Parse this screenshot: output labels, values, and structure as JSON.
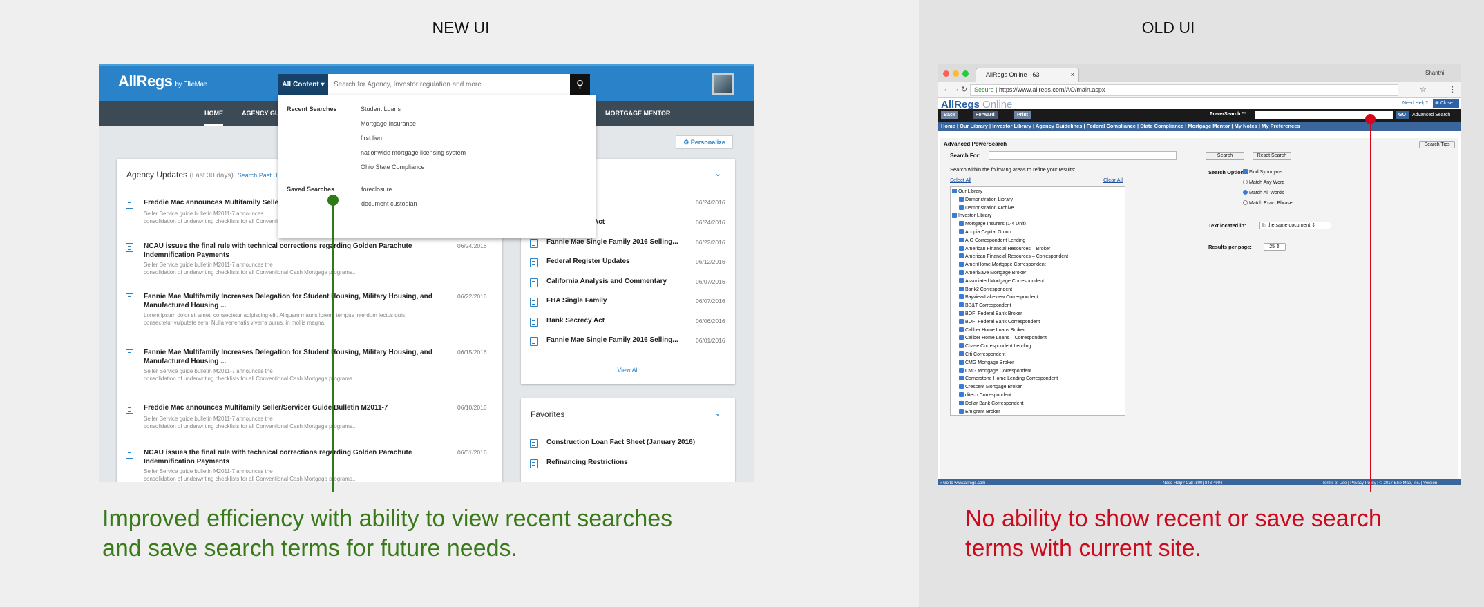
{
  "headings": {
    "new": "NEW UI",
    "old": "OLD UI"
  },
  "captions": {
    "new_lines": [
      "Improved efficiency with ability to view recent searches",
      "and save search terms for future needs."
    ],
    "old_lines": [
      "No ability to show recent or save search",
      "terms with current site."
    ],
    "colors": {
      "new": "#3a7a1a",
      "old": "#cc0a1e",
      "new_marker": "#2f7a17",
      "old_marker": "#d3061b"
    }
  },
  "new_ui": {
    "logo": "AllRegs",
    "logo_suffix": "by EllieMae",
    "search": {
      "scope": "All Content",
      "placeholder": "Search for Agency, Investor regulation and more..."
    },
    "nav": [
      "HOME",
      "AGENCY GUI",
      "MORTGAGE MENTOR"
    ],
    "personalize": "Personalize",
    "dropdown": {
      "recent_label": "Recent Searches",
      "recent": [
        "Student Loans",
        "Mortgage Insurance",
        "first lien",
        "nationwide mortgage licensing system",
        "Ohio State Compliance"
      ],
      "saved_label": "Saved Searches",
      "saved": [
        "foreclosure",
        "document custodian"
      ]
    },
    "agency": {
      "title": "Agency Updates",
      "subtitle": "(Last 30 days)",
      "link": "Search Past U",
      "items": [
        {
          "title": "Freddie Mac announces Multifamily Seller",
          "desc1": "Seller Service guide bulletin M2011-7 announces",
          "desc2": "consolidation of underwriting checklists for all Conventional Cash Mortgage programs...",
          "date": ""
        },
        {
          "title": "NCAU issues the final rule with technical corrections regarding Golden Parachute",
          "title2": "Indemnification Payments",
          "desc1": "Seller Service guide bulletin M2011-7 announces the",
          "desc2": "consolidation of underwriting checklists for all Conventional Cash Mortgage programs...",
          "date": "06/24/2016"
        },
        {
          "title": "Fannie Mae Multifamily Increases Delegation for Student Housing, Military Housing, and",
          "title2": "Manufactured Housing ...",
          "desc1": "Lorem ipsum dolor sit amet, consectetur adipiscing elit. Aliquam mauris lorem, tempus interdum lectus quis,",
          "desc2": "consectetur vulputate sem. Nulla venenatis viverra purus, in mollis magna.",
          "date": "06/22/2016"
        },
        {
          "title": "Fannie Mae Multifamily Increases Delegation for Student Housing, Military Housing, and",
          "title2": "Manufactured Housing ...",
          "desc1": "Seller Service guide bulletin M2011-7 announces the",
          "desc2": "consolidation of underwriting checklists for all Conventional Cash Mortgage programs...",
          "date": "06/15/2016"
        },
        {
          "title": "Freddie Mac announces Multifamily Seller/Servicer Guide Bulletin M2011-7",
          "desc1": "Seller Service guide bulletin M2011-7 announces the",
          "desc2": "consolidation of underwriting checklists for all Conventional Cash Mortgage programs...",
          "date": "06/10/2016"
        },
        {
          "title": "NCAU issues the final rule with technical corrections regarding Golden Parachute",
          "title2": "Indemnification Payments",
          "desc1": "Seller Service guide bulletin M2011-7 announces the",
          "desc2": "consolidation of underwriting checklists for all Conventional Cash Mortgage programs...",
          "date": "06/01/2016"
        }
      ]
    },
    "recent": {
      "items": [
        {
          "title": "nily",
          "date": "06/24/2016"
        },
        {
          "title": "Bank Secrecy Act",
          "date": "06/24/2016"
        },
        {
          "title": "Fannie Mae Single Family 2016 Selling...",
          "date": "06/22/2016"
        },
        {
          "title": "Federal Register Updates",
          "date": "06/12/2016"
        },
        {
          "title": "California Analysis and Commentary",
          "date": "06/07/2016"
        },
        {
          "title": "FHA Single Family",
          "date": "06/07/2016"
        },
        {
          "title": "Bank Secrecy Act",
          "date": "06/06/2016"
        },
        {
          "title": "Fannie Mae Single Family 2016 Selling...",
          "date": "06/01/2016"
        }
      ],
      "view_all": "View All"
    },
    "favorites": {
      "title": "Favorites",
      "items": [
        "Construction Loan Fact Sheet (January 2016)",
        "Refinancing Restrictions"
      ]
    }
  },
  "old_ui": {
    "tab": "AllRegs Online - 63",
    "user": "Shanthi",
    "url_secure": "Secure",
    "url": "https://www.allregs.com/AO/main.aspx",
    "logo": "AllRegs",
    "logo_suffix": "Online",
    "help": "Need Help?",
    "close": "Close",
    "buttons": {
      "back": "Back",
      "forward": "Forward",
      "print": "Print",
      "go": "GO",
      "power": "PowerSearch ™",
      "advanced": "Advanced Search"
    },
    "menu": "Home | Our Library | Investor Library | Agency Guidelines | Federal Compliance | State Compliance | Mortgage Mentor | My Notes | My Preferences",
    "form": {
      "title": "Advanced PowerSearch",
      "tips": "Search Tips",
      "search_for": "Search For:",
      "search_btn": "Search",
      "reset_btn": "Reset Search",
      "within": "Search within the following areas to refine your results:",
      "select_all": "Select All",
      "clear_all": "Clear All",
      "libraries": [
        "Our Library",
        "Demonstration Library",
        "Demonstration Archive",
        "Investor Library",
        "Mortgage Insurers (1-4 Unit)",
        "Acopia Capital Group",
        "AIG Correspondent Lending",
        "American Financial Resources – Broker",
        "American Financial Resources – Correspondent",
        "AmeriHome Mortgage Correspondent",
        "AmeriSave Mortgage Broker",
        "Associated Mortgage Correspondent",
        "Bank2 Correspondent",
        "Bayview/Lakeview Correspondent",
        "BB&T Correspondent",
        "BOFI Federal Bank Broker",
        "BOFI Federal Bank Correspondent",
        "Caliber Home Loans Broker",
        "Caliber Home Loans – Correspondent",
        "Chase Correspondent Lending",
        "Citi Correspondent",
        "CMG Mortgage Broker",
        "CMG Mortgage Correspondent",
        "Cornerstone Home Lending Correspondent",
        "Crescent Mortgage Broker",
        "ditech Correspondent",
        "Dollar Bank Correspondent",
        "Emigrant Broker"
      ],
      "options_label": "Search Options:",
      "options": [
        "Find Synonyms",
        "Match Any Word",
        "Match All Words",
        "Match Exact Phrase"
      ],
      "text_located": "Text located in:",
      "text_located_value": "In the same document",
      "results_label": "Results per page:",
      "results_value": "25"
    },
    "footer": {
      "left": "» Go to www.allregs.com",
      "mid": "Need Help? Call (800) 848-4904",
      "right": "Terms of Use | Privacy Policy | © 2017 Ellie Mae, Inc. | Version"
    }
  }
}
